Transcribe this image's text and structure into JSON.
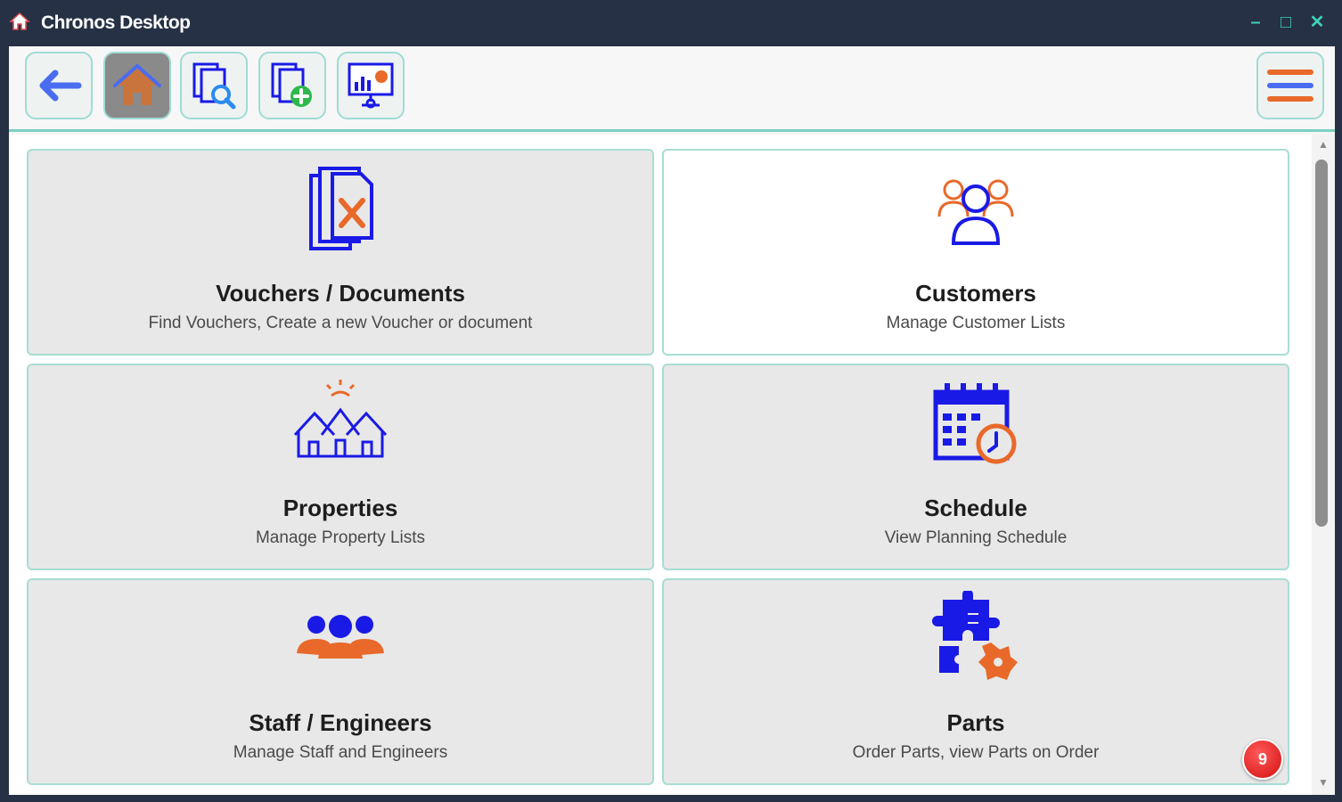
{
  "window": {
    "title": "Chronos Desktop",
    "icon": "home-icon",
    "controls": [
      "minimize",
      "maximize",
      "close"
    ],
    "minimize_glyph": "–",
    "maximize_glyph": "□",
    "close_glyph": "✕"
  },
  "toolbar": {
    "buttons": [
      {
        "name": "back-button",
        "icon": "arrow-left-icon",
        "active": false
      },
      {
        "name": "home-button",
        "icon": "home-icon",
        "active": true
      },
      {
        "name": "search-documents-button",
        "icon": "document-search-icon",
        "active": false
      },
      {
        "name": "new-document-button",
        "icon": "document-add-icon",
        "active": false
      },
      {
        "name": "dashboard-button",
        "icon": "presentation-chart-icon",
        "active": false
      }
    ],
    "menu_icon": "hamburger-menu-icon"
  },
  "tiles": [
    {
      "title": "Vouchers / Documents",
      "subtitle": "Find Vouchers, Create a new Voucher or document",
      "icon": "documents-tools-icon"
    },
    {
      "title": "Customers",
      "subtitle": "Manage Customer Lists",
      "icon": "customers-group-icon"
    },
    {
      "title": "Properties",
      "subtitle": "Manage Property Lists",
      "icon": "houses-icon"
    },
    {
      "title": "Schedule",
      "subtitle": "View Planning Schedule",
      "icon": "calendar-clock-icon"
    },
    {
      "title": "Staff / Engineers",
      "subtitle": "Manage Staff and Engineers",
      "icon": "team-icon"
    },
    {
      "title": "Parts",
      "subtitle": "Order Parts, view Parts on Order",
      "icon": "puzzle-parts-icon"
    }
  ],
  "badge": {
    "count": "9",
    "color": "#e01b1b"
  },
  "colors": {
    "accent_teal": "#7ccfc3",
    "icon_blue": "#1a1ae6",
    "icon_orange": "#e8692a",
    "titlebar": "#263145"
  }
}
